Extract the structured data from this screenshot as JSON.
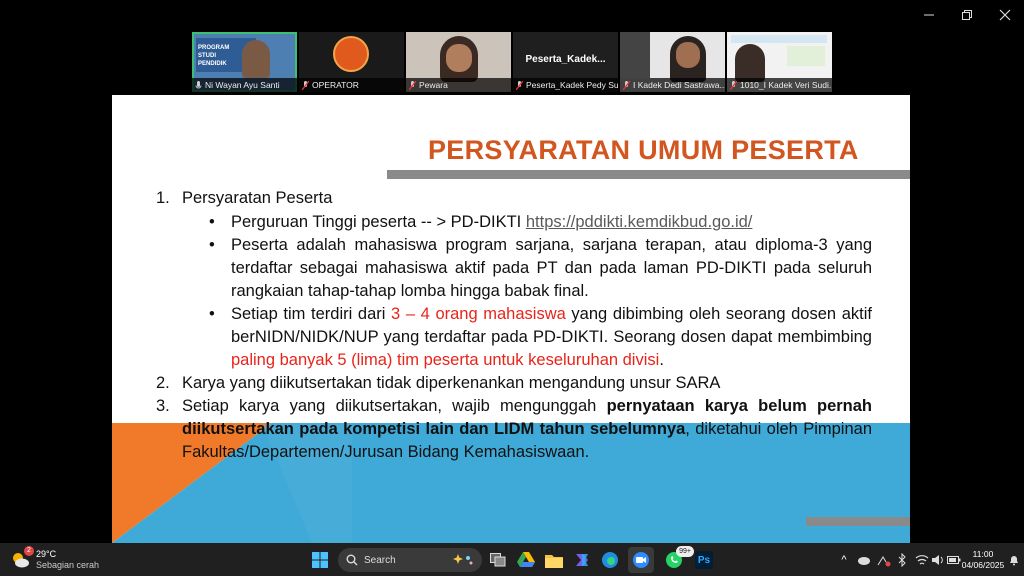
{
  "window": {
    "minimize_label": "–",
    "restore_label": "❐",
    "close_label": "✕"
  },
  "participants": [
    {
      "name": "Ni Wayan Ayu Santi",
      "muted": false,
      "thumb_text": "PROGRAM STUDI PENDIDIK"
    },
    {
      "name": "OPERATOR",
      "muted": true
    },
    {
      "name": "Pewara",
      "muted": true
    },
    {
      "name": "Peserta_Kadek Pedy Su...",
      "muted": true,
      "display_text": "Peserta_Kadek..."
    },
    {
      "name": "I Kadek Dedi Sastrawa...",
      "muted": true
    },
    {
      "name": "1010_I Kadek Veri Sudi...",
      "muted": true
    }
  ],
  "slide": {
    "title": "PERSYARATAN UMUM PESERTA",
    "item1": {
      "num": "1.",
      "label": "Persyaratan Peserta",
      "bullet1_text": "Perguruan Tinggi peserta -- > PD-DIKTI",
      "bullet1_link": "https://pddikti.kemdikbud.go.id/",
      "bullet2_text": "Peserta adalah mahasiswa program sarjana, sarjana terapan, atau diploma-3 yang terdaftar sebagai mahasiswa aktif pada PT dan pada laman PD-DIKTI pada seluruh rangkaian tahap-tahap lomba hingga babak final.",
      "bullet3_a": "Setiap tim terdiri dari",
      "bullet3_red1": "3 – 4 orang mahasiswa",
      "bullet3_b": "yang dibimbing oleh seorang dosen aktif berNIDN/NIDK/NUP yang terdaftar pada PD-DIKTI. Seorang dosen dapat membimbing",
      "bullet3_red2": "paling banyak 5 (lima) tim peserta untuk keseluruhan divisi",
      "bullet3_end": "."
    },
    "item2": {
      "num": "2.",
      "text": "Karya yang diikutsertakan tidak diperkenankan mengandung unsur SARA"
    },
    "item3": {
      "num": "3.",
      "a": "Setiap karya yang diikutsertakan, wajib mengunggah",
      "bold": "pernyataan karya belum pernah diikutsertakan pada kompetisi lain dan LIDM tahun sebelumnya",
      "b": ", diketahui oleh Pimpinan Fakultas/Departemen/Jurusan Bidang Kemahasiswaan."
    },
    "bullet_char": "•",
    "colors": {
      "title": "#d2561f",
      "red": "#e8241a",
      "orange": "#f07a2a",
      "blue": "#3fa9d8"
    }
  },
  "taskbar": {
    "weather_temp": "29°C",
    "weather_desc": "Sebagian cerah",
    "weather_badge": "2",
    "search_placeholder": "Search",
    "whatsapp_badge": "99+",
    "photoshop_label": "Ps",
    "time": "11:00",
    "date": "04/06/2025",
    "tray_up_arrow": "^"
  }
}
